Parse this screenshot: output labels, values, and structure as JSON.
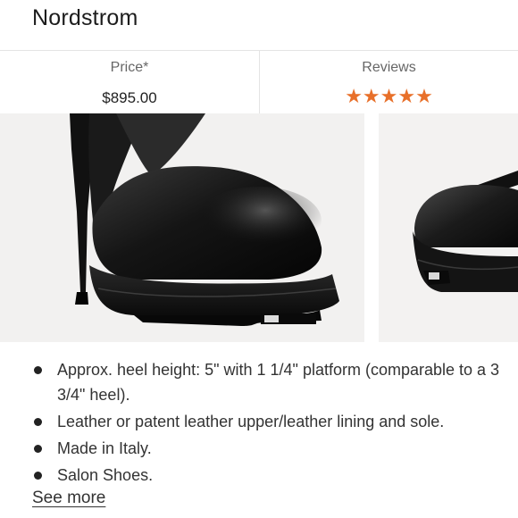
{
  "header": {
    "store_name": "Nordstrom"
  },
  "stats": {
    "price_label": "Price*",
    "price_value": "$895.00",
    "reviews_label": "Reviews",
    "rating_stars": "★★★★★",
    "star_color": "#e8702a"
  },
  "features": [
    "Approx. heel height: 5\" with 1 1/4\" platform (comparable to a 3 3/4\" heel).",
    "Leather or patent leather upper/leather lining and sole.",
    "Made in Italy.",
    "Salon Shoes."
  ],
  "see_more_label": "See more"
}
